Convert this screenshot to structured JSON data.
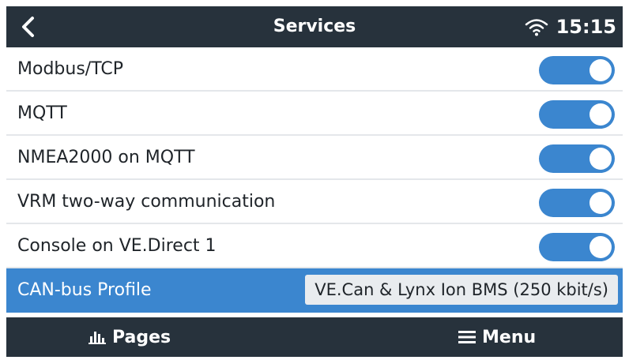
{
  "header": {
    "title": "Services",
    "time": "15:15"
  },
  "services": [
    {
      "label": "Modbus/TCP",
      "enabled": true
    },
    {
      "label": "MQTT",
      "enabled": true
    },
    {
      "label": "NMEA2000 on MQTT",
      "enabled": true
    },
    {
      "label": "VRM two-way communication",
      "enabled": true
    },
    {
      "label": "Console on VE.Direct 1",
      "enabled": true
    }
  ],
  "canbus": {
    "label": "CAN-bus Profile",
    "value": "VE.Can & Lynx Ion BMS (250 kbit/s)"
  },
  "footer": {
    "pages_label": "Pages",
    "menu_label": "Menu"
  },
  "colors": {
    "header_bg": "#27323c",
    "accent": "#3b86cf"
  },
  "icons": {
    "back": "chevron-left-icon",
    "wifi": "wifi-icon",
    "pages": "bar-chart-icon",
    "menu": "hamburger-icon"
  }
}
